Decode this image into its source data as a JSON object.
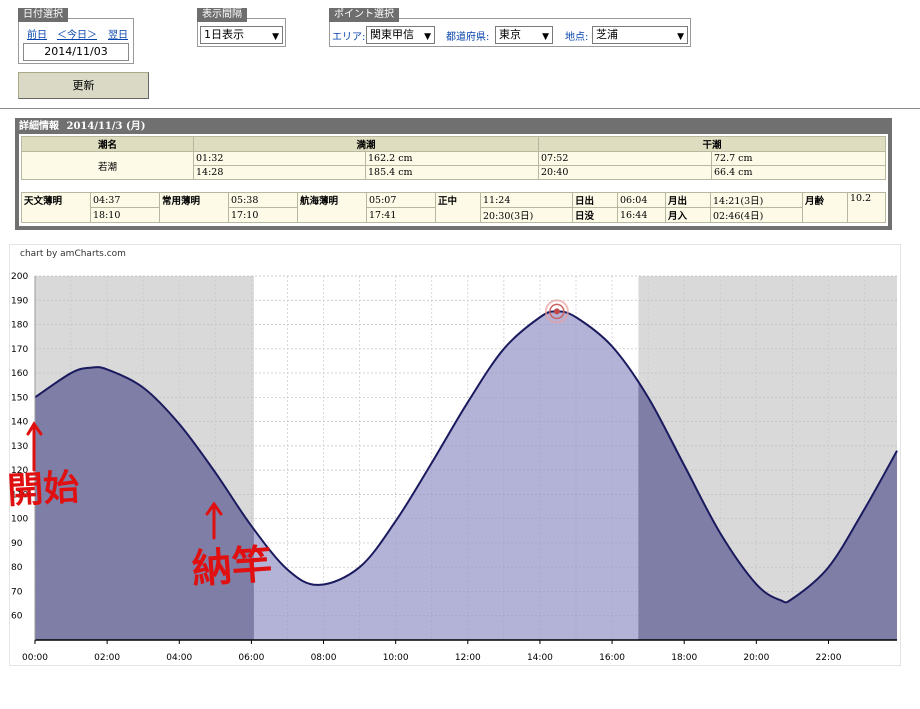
{
  "date_select": {
    "tab": "日付選択",
    "prev": "前日",
    "today": "＜今日＞",
    "next": "翌日",
    "date": "2014/11/03",
    "update": "更新"
  },
  "interval_select": {
    "tab": "表示間隔",
    "value": "1日表示"
  },
  "point_select": {
    "tab": "ポイント選択",
    "area_label": "エリア:",
    "area_value": "関東甲信",
    "pref_label": "都道府県:",
    "pref_value": "東京",
    "spot_label": "地点:",
    "spot_value": "芝浦"
  },
  "detail": {
    "title": "詳細情報",
    "date": "2014/11/3 (月)",
    "headers": {
      "tide_name": "潮名",
      "high": "満潮",
      "low": "干潮"
    },
    "tide_name": "若潮",
    "high": [
      {
        "time": "01:32",
        "height": "162.2 cm"
      },
      {
        "time": "14:28",
        "height": "185.4 cm"
      }
    ],
    "low": [
      {
        "time": "07:52",
        "height": "72.7 cm"
      },
      {
        "time": "20:40",
        "height": "66.4 cm"
      }
    ],
    "twilight": {
      "astro_label": "天文薄明",
      "astro": [
        "04:37",
        "18:10"
      ],
      "civil_label": "常用薄明",
      "civil": [
        "05:38",
        "17:10"
      ],
      "nautical_label": "航海薄明",
      "nautical": [
        "05:07",
        "17:41"
      ],
      "noon_label": "正中",
      "noon": [
        "11:24",
        "20:30(3日)"
      ],
      "sunrise_label": "日出",
      "sunrise": "06:04",
      "sunset_label": "日没",
      "sunset": "16:44",
      "moonrise_label": "月出",
      "moonrise": "14:21(3日)",
      "moonset_label": "月入",
      "moonset": "02:46(4日)",
      "moonage_label": "月齢",
      "moonage": "10.2"
    }
  },
  "chart_credit": "chart by amCharts.com",
  "annotations": {
    "start": "開始",
    "fishing": "納竿"
  },
  "chart_data": {
    "type": "area",
    "x_label_values": [
      "00:00",
      "02:00",
      "04:00",
      "06:00",
      "08:00",
      "10:00",
      "12:00",
      "14:00",
      "16:00",
      "18:00",
      "20:00",
      "22:00"
    ],
    "y_ticks": [
      60,
      70,
      80,
      90,
      100,
      110,
      120,
      130,
      140,
      150,
      160,
      170,
      180,
      190,
      200
    ],
    "ylim": [
      50,
      200
    ],
    "xlim_hours": [
      0,
      23.9
    ],
    "night_bands_hours": [
      [
        0,
        6.07
      ],
      [
        16.73,
        24
      ]
    ],
    "series": [
      {
        "hours": [
          0,
          1,
          1.53,
          2,
          3,
          4,
          5,
          6,
          7,
          7.87,
          9,
          10,
          11,
          12,
          13,
          14,
          14.47,
          15,
          16,
          17,
          18,
          19,
          20,
          20.67,
          21,
          22,
          23,
          23.9
        ],
        "values": [
          150,
          160,
          162.2,
          161.5,
          154,
          139,
          119,
          97,
          79,
          72.7,
          80,
          99,
          123,
          148,
          170,
          183,
          185.4,
          183,
          171,
          150,
          122,
          94,
          73,
          66.4,
          67,
          80,
          104,
          128
        ]
      }
    ],
    "highlight_point": {
      "hour": 14.47,
      "value": 185.4
    },
    "grid": true
  }
}
